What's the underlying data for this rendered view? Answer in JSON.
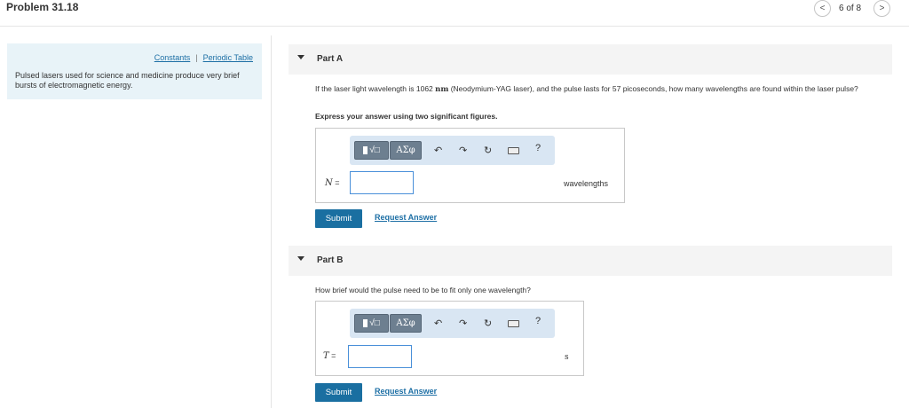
{
  "header": {
    "problem_title": "Problem 31.18",
    "page_count": "6 of 8",
    "prev_glyph": "<",
    "next_glyph": ">"
  },
  "sidebar": {
    "constants_link": "Constants",
    "separator": "|",
    "periodic_table_link": "Periodic Table",
    "intro_text": "Pulsed lasers used for science and medicine produce very brief bursts of electromagnetic energy."
  },
  "toolbar": {
    "templates_symbol": "√□",
    "symbols_label": "ΑΣφ",
    "undo_glyph": "↶",
    "redo_glyph": "↷",
    "reset_glyph": "↻",
    "help_glyph": "?"
  },
  "part_a": {
    "label": "Part A",
    "question_before_unit": "If the laser light wavelength is 1062 ",
    "question_unit": "nm",
    "question_after_unit": " (Neodymium-YAG laser), and the pulse lasts for 57 picoseconds, how many wavelengths are found within the laser pulse?",
    "instruction": "Express your answer using two significant figures.",
    "variable": "N",
    "equals": " =",
    "input_value": "",
    "unit": "wavelengths",
    "submit_label": "Submit",
    "request_label": "Request Answer"
  },
  "part_b": {
    "label": "Part B",
    "question": "How brief would the pulse need to be to fit only one wavelength?",
    "variable": "T",
    "equals": " =",
    "input_value": "",
    "unit": "s",
    "submit_label": "Submit",
    "request_label": "Request Answer"
  }
}
